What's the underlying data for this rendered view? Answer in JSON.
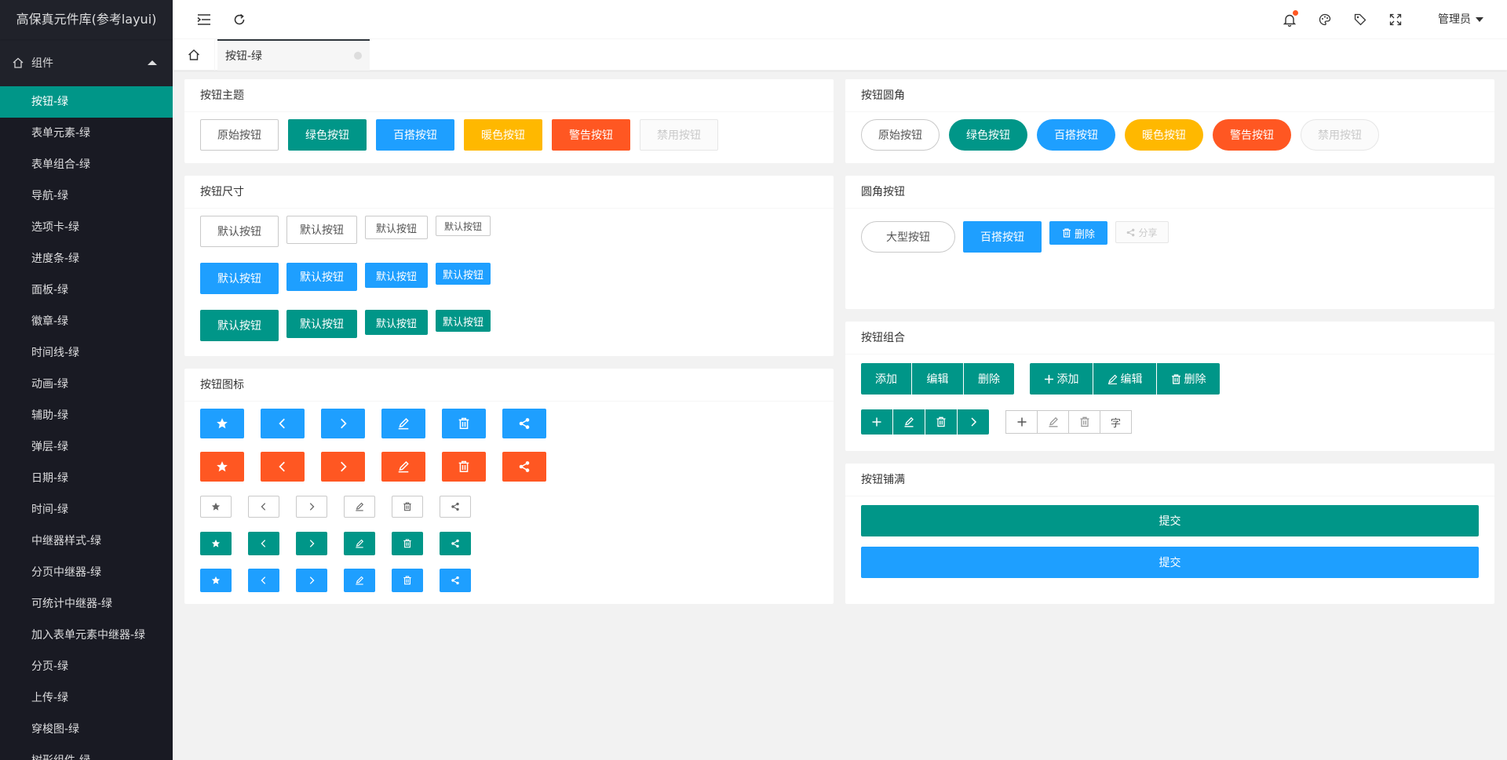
{
  "app": {
    "title": "高保真元件库(参考layui)"
  },
  "sidebar": {
    "group_label": "组件",
    "items": [
      "按钮-绿",
      "表单元素-绿",
      "表单组合-绿",
      "导航-绿",
      "选项卡-绿",
      "进度条-绿",
      "面板-绿",
      "徽章-绿",
      "时间线-绿",
      "动画-绿",
      "辅助-绿",
      "弹层-绿",
      "日期-绿",
      "时间-绿",
      "中继器样式-绿",
      "分页中继器-绿",
      "可统计中继器-绿",
      "加入表单元素中继器-绿",
      "分页-绿",
      "上传-绿",
      "穿梭图-绿",
      "树形组件-绿"
    ],
    "active_index": 0
  },
  "header": {
    "user_label": "管理员",
    "icons": [
      "menu-fold-icon",
      "refresh-icon",
      "bell-icon",
      "palette-icon",
      "tag-icon",
      "fullscreen-icon"
    ]
  },
  "tabs": {
    "active": "按钮-绿"
  },
  "cards": {
    "theme": {
      "title": "按钮主题",
      "buttons": [
        "原始按钮",
        "绿色按钮",
        "百搭按钮",
        "暖色按钮",
        "警告按钮",
        "禁用按钮"
      ]
    },
    "size": {
      "title": "按钮尺寸",
      "label": "默认按钮"
    },
    "icon": {
      "title": "按钮图标"
    },
    "radius": {
      "title": "按钮圆角",
      "buttons": [
        "原始按钮",
        "绿色按钮",
        "百搭按钮",
        "暖色按钮",
        "警告按钮",
        "禁用按钮"
      ]
    },
    "round": {
      "title": "圆角按钮",
      "large": "大型按钮",
      "normal": "百搭按钮",
      "delete": "删除",
      "share": "分享"
    },
    "group": {
      "title": "按钮组合",
      "add": "添加",
      "edit": "编辑",
      "delete": "删除",
      "char": "字"
    },
    "fluid": {
      "title": "按钮铺满",
      "submit": "提交"
    }
  },
  "colors": {
    "green": "#009688",
    "blue": "#1e9fff",
    "warm": "#ffb800",
    "danger": "#ff5722",
    "sidebar": "#20222a"
  }
}
